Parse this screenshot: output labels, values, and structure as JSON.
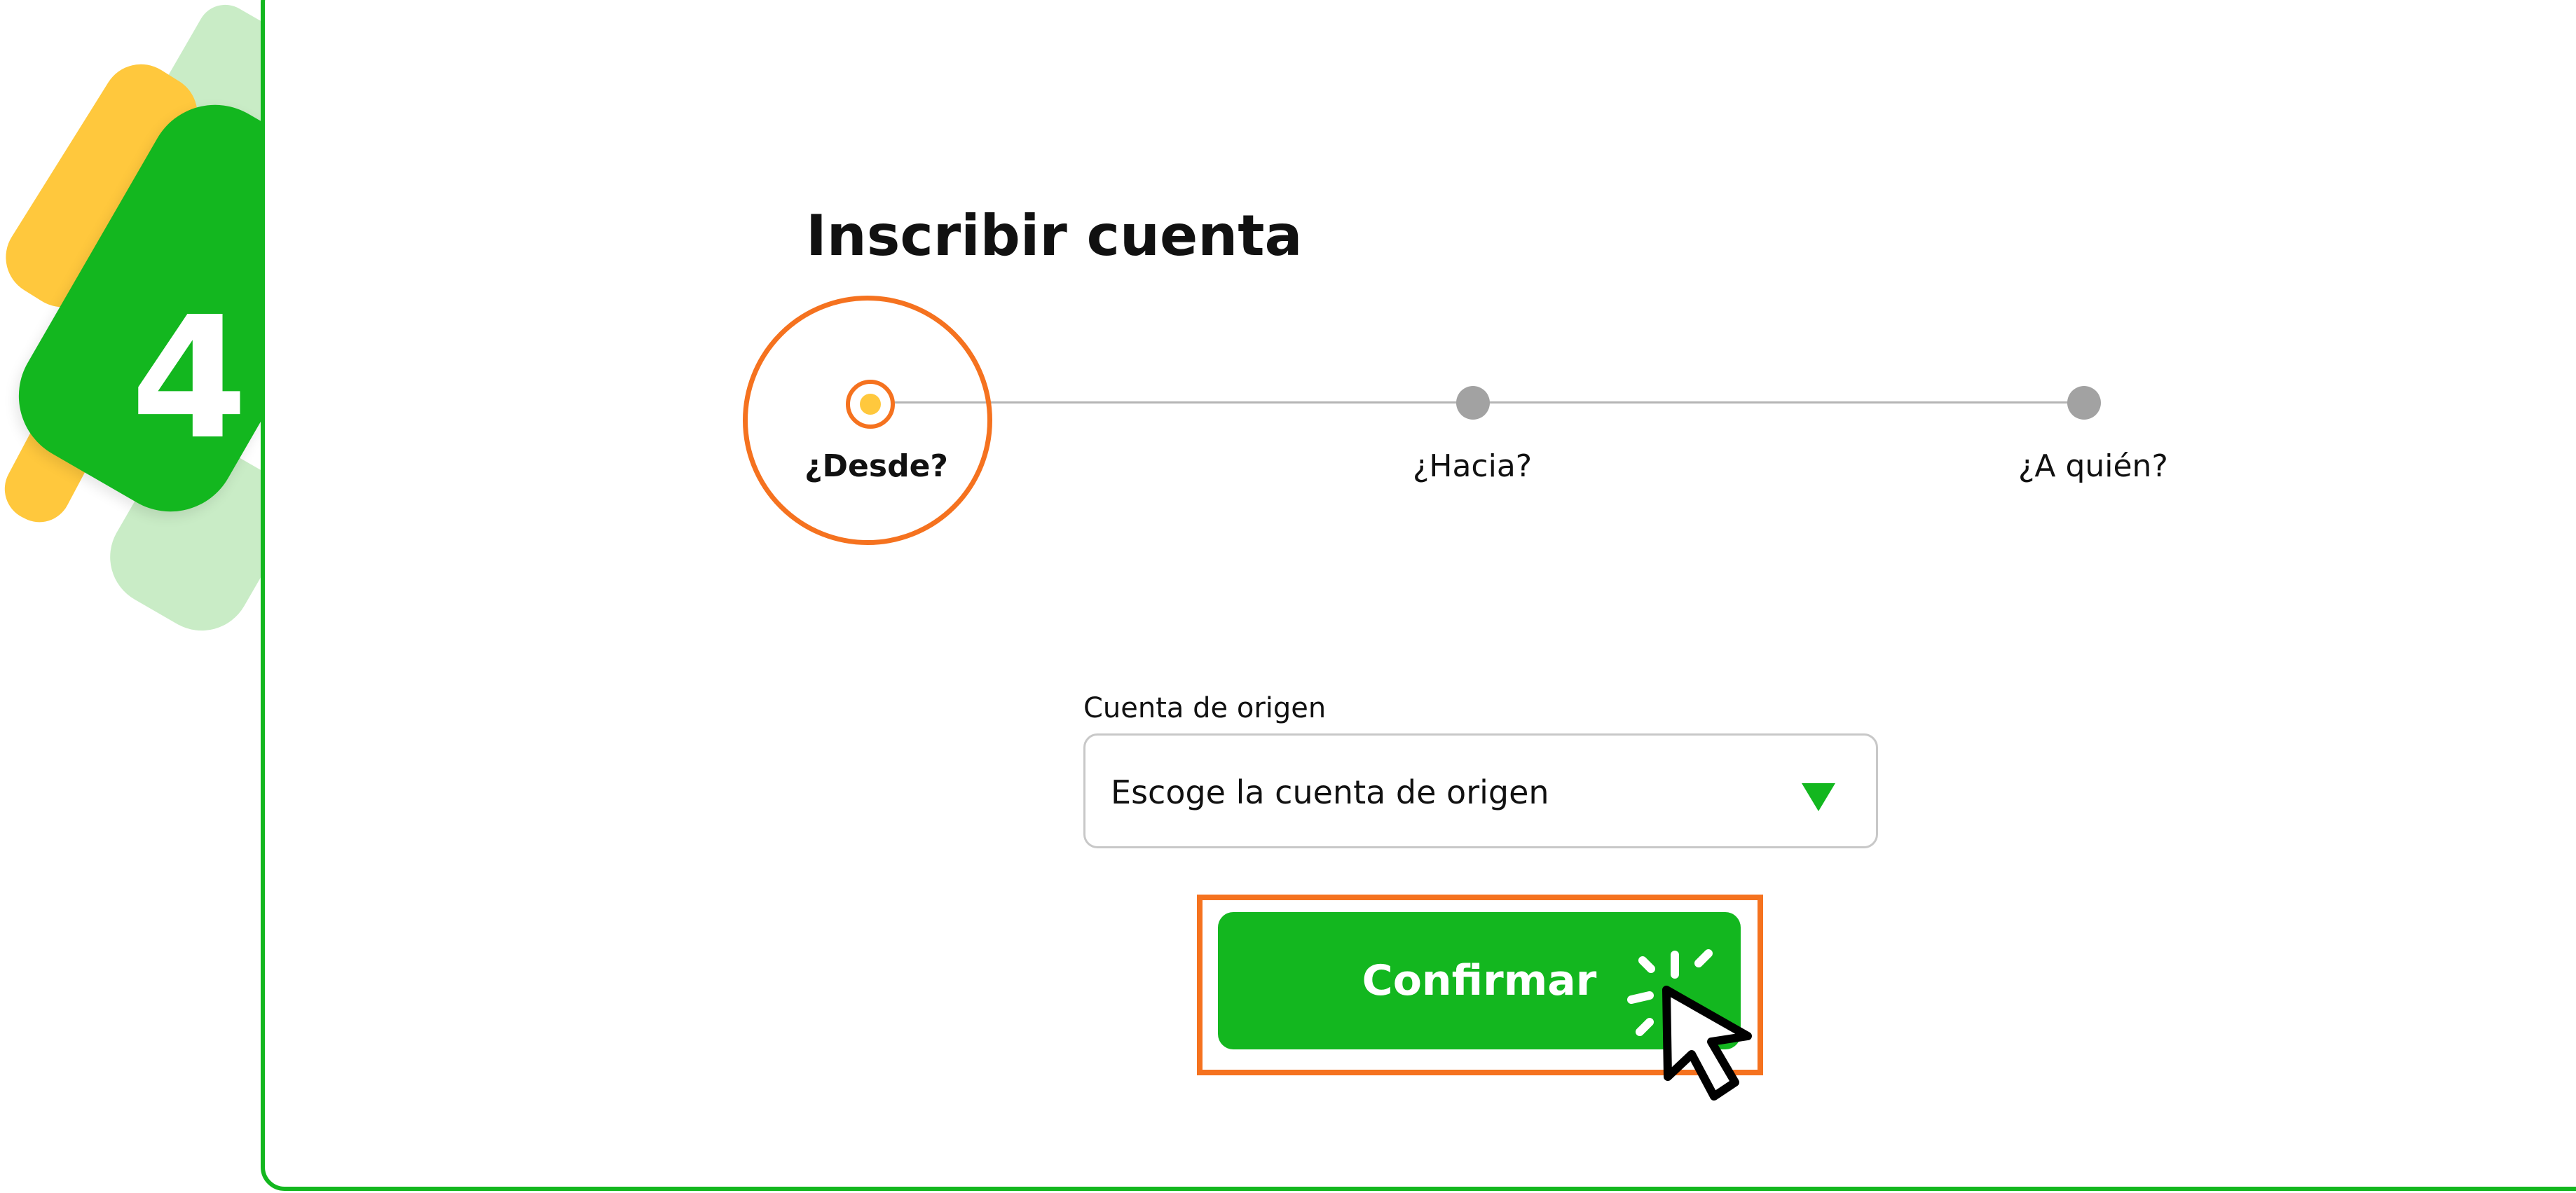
{
  "step_badge": {
    "number": "4"
  },
  "header": {
    "title": "Inscribir cuenta"
  },
  "stepper": {
    "steps": [
      {
        "label": "¿Desde?",
        "state": "active"
      },
      {
        "label": "¿Hacia?",
        "state": "pending"
      },
      {
        "label": "¿A quién?",
        "state": "pending"
      }
    ]
  },
  "form": {
    "origin_account": {
      "label": "Cuenta de origen",
      "value": "Escoge la cuenta de origen"
    },
    "confirm_label": "Confirmar"
  },
  "colors": {
    "brand_green": "#13b71f",
    "highlight_orange": "#f5721f",
    "accent_yellow": "#ffc83d",
    "pending_gray": "#a2a2a2"
  },
  "icons": {
    "dropdown": "triangle-down-icon",
    "cursor": "mouse-pointer-click-icon"
  }
}
